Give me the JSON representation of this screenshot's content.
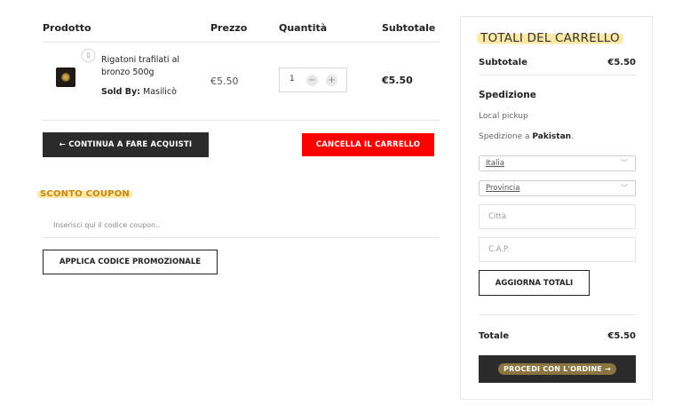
{
  "cart": {
    "headers": {
      "product": "Prodotto",
      "price": "Prezzo",
      "quantity": "Quantità",
      "subtotal": "Subtotale"
    },
    "items": [
      {
        "remove_icon": "remove-icon",
        "image_icon": "product-thumbnail",
        "name": "Rigatoni trafilati al bronzo 500g",
        "sold_by_label": "Sold By:",
        "vendor": "Masilicò",
        "price": "€5.50",
        "quantity": "1",
        "minus": "−",
        "plus": "+",
        "subtotal": "€5.50"
      }
    ],
    "continue_button": "← CONTINUA A FARE ACQUISTI",
    "clear_button": "CANCELLA IL CARRELLO"
  },
  "coupon": {
    "title": "SCONTO COUPON",
    "placeholder": "Inserisci qui il codice coupon..",
    "apply_button": "APPLICA CODICE PROMOZIONALE"
  },
  "totals": {
    "title": "TOTALI DEL CARRELLO",
    "subtotal_label": "Subtotale",
    "subtotal_value": "€5.50",
    "shipping_title": "Spedizione",
    "shipping_method": "Local pickup",
    "shipping_to_prefix": "Spedizione a",
    "shipping_country": "Pakistan",
    "shipping_to_suffix": ".",
    "country_select": "Italia",
    "province_select": "Provincia",
    "city_placeholder": "Città",
    "zip_placeholder": "C.A.P.",
    "update_button": "AGGIORNA TOTALI",
    "total_label": "Totale",
    "total_value": "€5.50",
    "checkout_button": "PROCEDI CON L'ORDINE →"
  },
  "colors": {
    "accent_highlight": "#fde9a6",
    "coupon_title": "#c8871a",
    "clear_button": "#ff0000",
    "dark_button": "#2b2b2b"
  }
}
